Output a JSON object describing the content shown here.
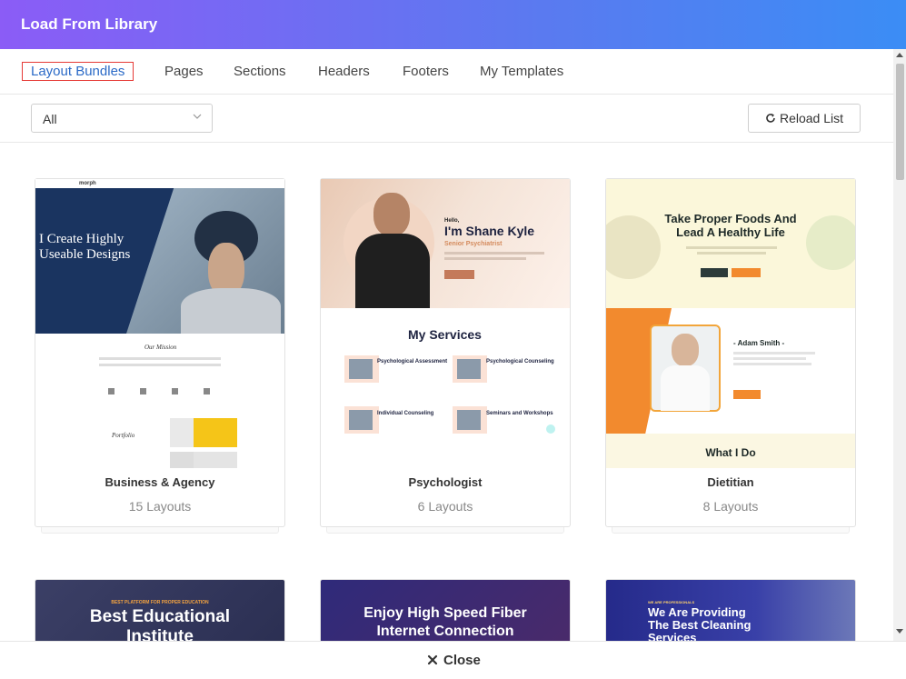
{
  "dialog": {
    "title": "Load From Library"
  },
  "tabs": [
    {
      "label": "Layout Bundles",
      "active": true
    },
    {
      "label": "Pages"
    },
    {
      "label": "Sections"
    },
    {
      "label": "Headers"
    },
    {
      "label": "Footers"
    },
    {
      "label": "My Templates"
    }
  ],
  "filter": {
    "selected": "All",
    "icon": "chevron-down-icon"
  },
  "reload": {
    "label": "Reload List",
    "icon": "reload-icon"
  },
  "cards": [
    {
      "title": "Business & Agency",
      "count": "15 Layouts",
      "preview": {
        "brand": "morph",
        "headline1": "I Create Highly",
        "headline2": "Useable Designs",
        "section": "Our Mission",
        "portfolio": "Portfolio"
      }
    },
    {
      "title": "Psychologist",
      "count": "6 Layouts",
      "preview": {
        "hello": "Hello,",
        "name": "I'm Shane Kyle",
        "role": "Senior Psychiatrist",
        "section": "My Services",
        "services": [
          "Psychological Assessment",
          "Psychological Counseling",
          "Individual Counseling",
          "Seminars and Workshops"
        ]
      }
    },
    {
      "title": "Dietitian",
      "count": "8 Layouts",
      "preview": {
        "headline1": "Take Proper Foods And",
        "headline2": "Lead A Healthy Life",
        "name": "- Adam Smith -",
        "section": "What I Do"
      }
    }
  ],
  "cards_row2": [
    {
      "preview": {
        "tag": "BEST PLATFORM FOR PROPER EDUCATION",
        "headline1": "Best Educational",
        "headline2": "Institute"
      }
    },
    {
      "preview": {
        "headline1": "Enjoy High Speed Fiber",
        "headline2": "Internet Connection"
      }
    },
    {
      "preview": {
        "tag": "WE ARE PROFESSIONALS",
        "headline1": "We Are Providing",
        "headline2": "The Best Cleaning",
        "headline3": "Services"
      }
    }
  ],
  "footer": {
    "close_label": "Close",
    "icon": "close-icon"
  },
  "colors": {
    "header_start": "#8b5cf6",
    "header_end": "#3b8df5",
    "active_tab": "#2b6ac7",
    "active_outline": "#e53935"
  }
}
